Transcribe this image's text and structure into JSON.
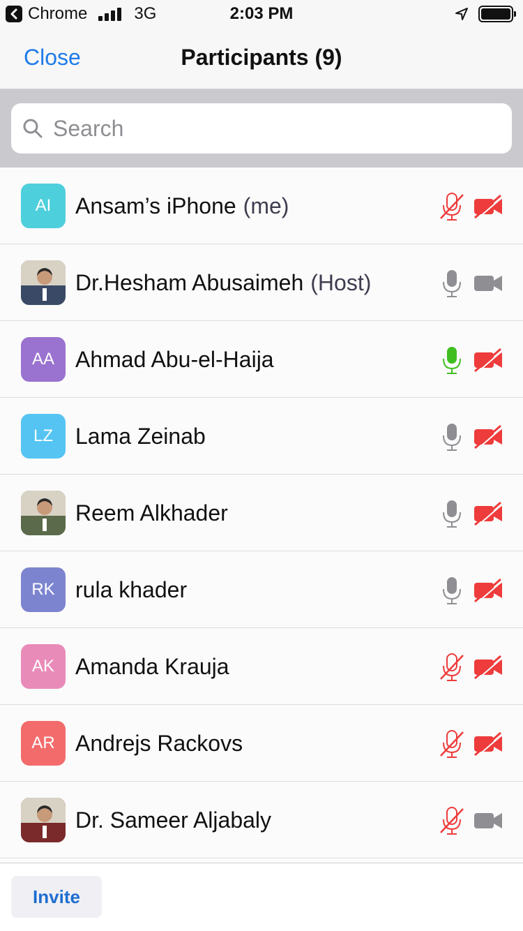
{
  "status_bar": {
    "back_app": "Chrome",
    "network": "3G",
    "time": "2:03 PM"
  },
  "header": {
    "close_label": "Close",
    "title": "Participants (9)"
  },
  "search": {
    "placeholder": "Search"
  },
  "participants": [
    {
      "initials": "AI",
      "name": "Ansam’s iPhone",
      "suffix": "(me)",
      "avatar_type": "initials",
      "avatar_color": "#4ecfdc",
      "mic": "muted",
      "video": "off"
    },
    {
      "initials": "",
      "name": "Dr.Hesham Abusaimeh",
      "suffix": "(Host)",
      "avatar_type": "photo",
      "avatar_color": "#3a4a66",
      "mic": "on",
      "video": "on"
    },
    {
      "initials": "AA",
      "name": "Ahmad Abu-el-Haija",
      "suffix": "",
      "avatar_type": "initials",
      "avatar_color": "#9a72cf",
      "mic": "speaking",
      "video": "off"
    },
    {
      "initials": "LZ",
      "name": "Lama Zeinab",
      "suffix": "",
      "avatar_type": "initials",
      "avatar_color": "#55c4f3",
      "mic": "on",
      "video": "off"
    },
    {
      "initials": "",
      "name": "Reem Alkhader",
      "suffix": "",
      "avatar_type": "photo",
      "avatar_color": "#5a6a4a",
      "mic": "on",
      "video": "off"
    },
    {
      "initials": "RK",
      "name": "rula khader",
      "suffix": "",
      "avatar_type": "initials",
      "avatar_color": "#7d84cf",
      "mic": "on",
      "video": "off"
    },
    {
      "initials": "AK",
      "name": "Amanda Krauja",
      "suffix": "",
      "avatar_type": "initials",
      "avatar_color": "#e98bb8",
      "mic": "muted",
      "video": "off"
    },
    {
      "initials": "AR",
      "name": "Andrejs Rackovs",
      "suffix": "",
      "avatar_type": "initials",
      "avatar_color": "#f36b6b",
      "mic": "muted",
      "video": "off"
    },
    {
      "initials": "",
      "name": "Dr. Sameer Aljabaly",
      "suffix": "",
      "avatar_type": "photo",
      "avatar_color": "#7a2a2a",
      "mic": "muted",
      "video": "on"
    }
  ],
  "footer": {
    "invite_label": "Invite"
  },
  "colors": {
    "accent": "#1e7bea",
    "muted_red": "#ee3b3b",
    "speaking_green": "#3fbf1f",
    "icon_gray": "#8e8e93"
  }
}
